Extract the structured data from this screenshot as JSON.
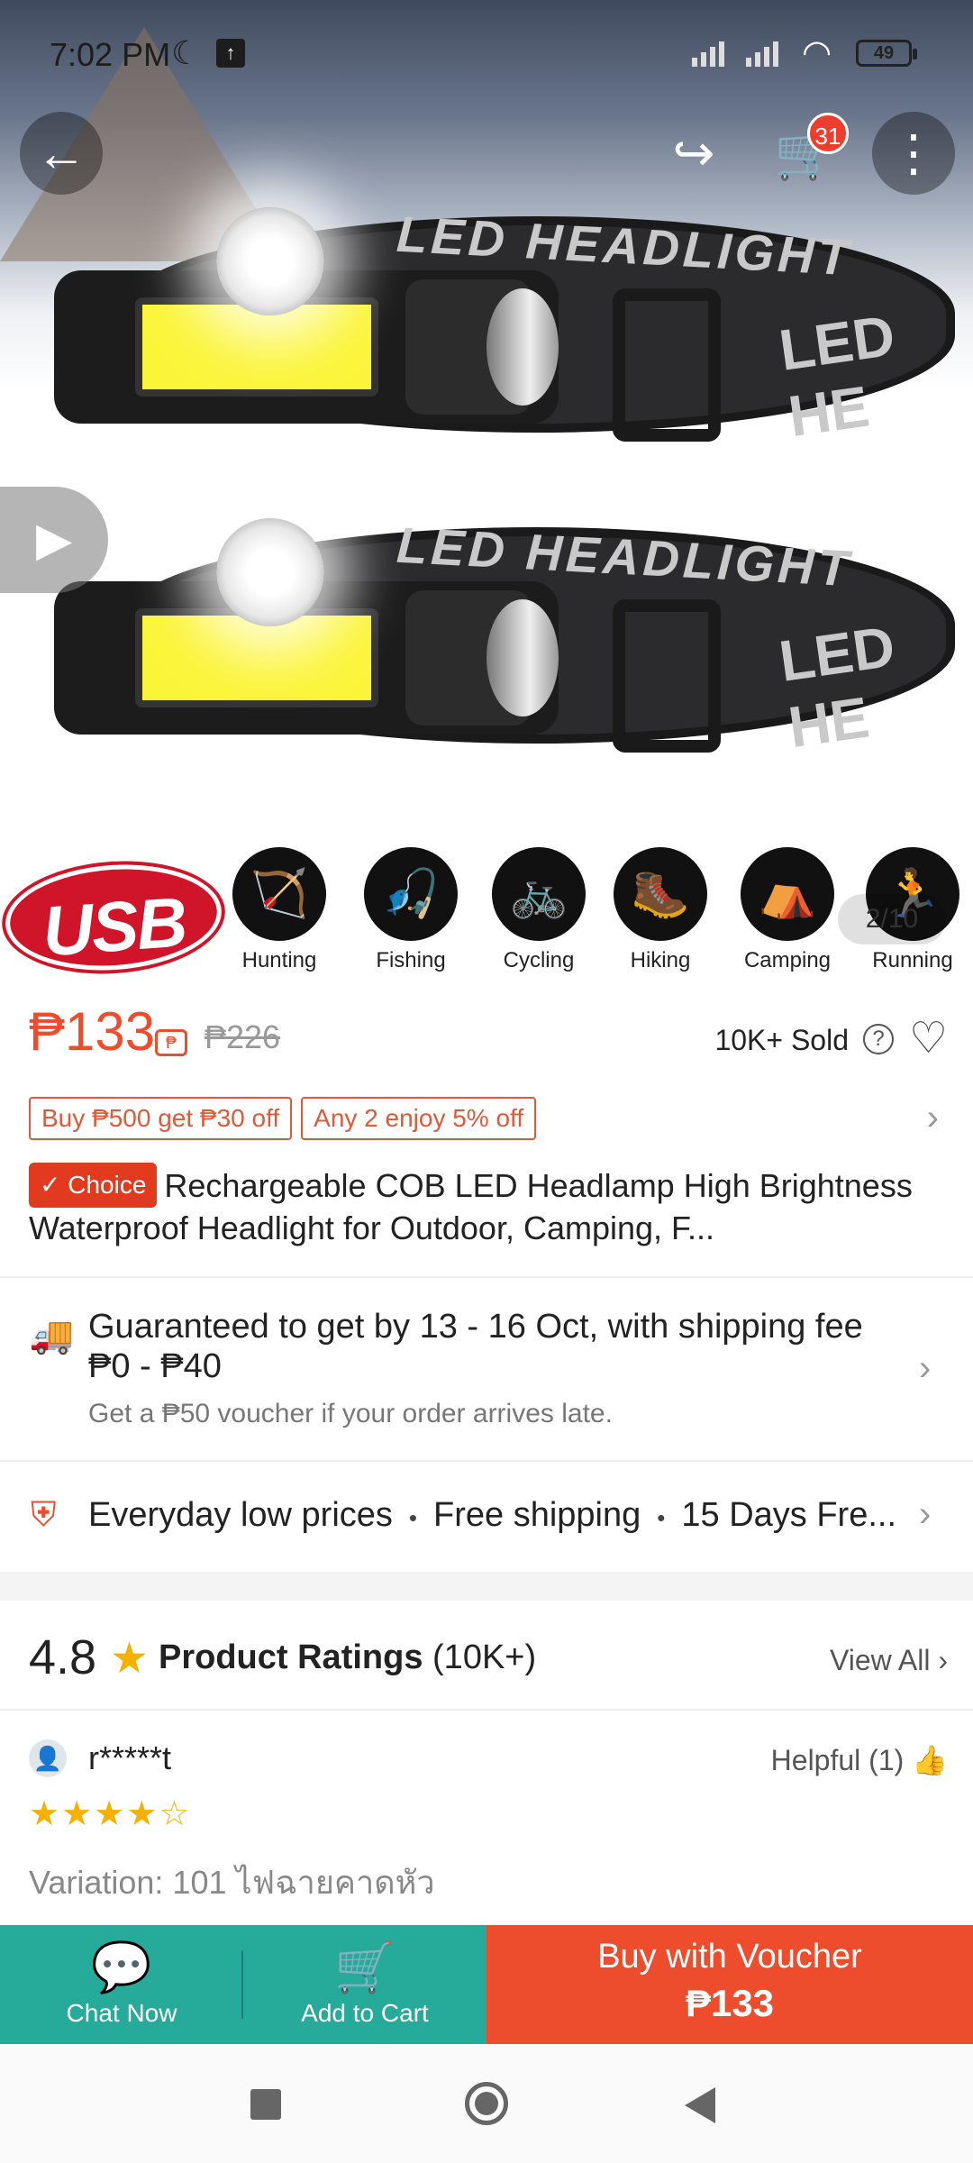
{
  "status_bar": {
    "time": "7:02 PM",
    "battery": "49"
  },
  "header": {
    "back_icon": "arrow-left-icon",
    "share_icon": "share-icon",
    "cart_icon": "cart-icon",
    "cart_count": "31",
    "more_icon": "more-vertical-icon"
  },
  "gallery": {
    "band_text": "LED HEADLIGHT",
    "band_text2": "LED HE",
    "usb_label": "USB",
    "activities": [
      {
        "label": "Hunting",
        "icon": "🏹"
      },
      {
        "label": "Fishing",
        "icon": "🎣"
      },
      {
        "label": "Cycling",
        "icon": "🚲"
      },
      {
        "label": "Hiking",
        "icon": "🥾"
      },
      {
        "label": "Camping",
        "icon": "⛺"
      },
      {
        "label": "Running",
        "icon": "🏃"
      }
    ],
    "counter": "2/10"
  },
  "product": {
    "price": "₱133",
    "old_price": "₱226",
    "sold": "10K+ Sold",
    "promos": [
      "Buy ₱500 get ₱30 off",
      "Any 2 enjoy 5% off"
    ],
    "choice_label": "✓ Choice",
    "title": "Rechargeable COB LED Headlamp High Brightness Waterproof Headlight for Outdoor, Camping, F..."
  },
  "shipping": {
    "main": "Guaranteed to get by 13 - 16 Oct, with shipping fee ₱0 - ₱40",
    "sub": "Get a ₱50 voucher if your order arrives late."
  },
  "benefits": [
    "Everyday low prices",
    "Free shipping",
    "15 Days Fre..."
  ],
  "ratings": {
    "score": "4.8",
    "title": "Product Ratings",
    "count": "(10K+)",
    "view_all": "View All"
  },
  "review": {
    "reviewer": "r*****t",
    "helpful": "Helpful (1)",
    "stars": 4,
    "variation": "Variation: 101 ไฟฉายคาดหัว"
  },
  "bottom_bar": {
    "chat_label": "Chat Now",
    "cart_label": "Add to Cart",
    "buy_label": "Buy with Voucher",
    "buy_price": "₱133"
  },
  "colors": {
    "accent": "#ee4d2d",
    "teal": "#26aa99",
    "star": "#f6b000"
  }
}
